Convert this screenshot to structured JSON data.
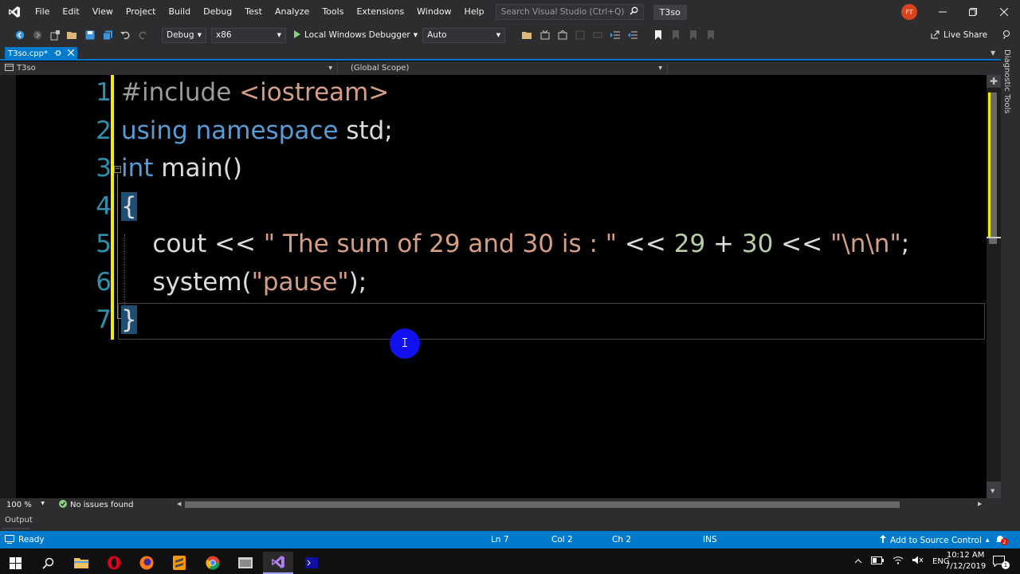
{
  "menubar": {
    "items": [
      "File",
      "Edit",
      "View",
      "Project",
      "Build",
      "Debug",
      "Test",
      "Analyze",
      "Tools",
      "Extensions",
      "Window",
      "Help"
    ],
    "search_placeholder": "Search Visual Studio (Ctrl+Q)",
    "solution_title": "T3so",
    "user_initials": "FT"
  },
  "toolbar": {
    "configuration": "Debug",
    "platform": "x86",
    "run_label": "Local Windows Debugger",
    "run_mode": "Auto",
    "live_share": "Live Share"
  },
  "tabs": [
    {
      "label": "T3so.cpp*",
      "active": true
    }
  ],
  "navbar": {
    "project": "T3so",
    "scope": "(Global Scope)"
  },
  "side_panel": {
    "diagnostic_tools": "Diagnostic Tools"
  },
  "editor": {
    "line_numbers": [
      "1",
      "2",
      "3",
      "4",
      "5",
      "6",
      "7"
    ],
    "lines": [
      [
        {
          "t": "#include ",
          "c": "pp"
        },
        {
          "t": "<iostream>",
          "c": "str"
        }
      ],
      [
        {
          "t": "using",
          "c": "kw"
        },
        {
          "t": " ",
          "c": ""
        },
        {
          "t": "namespace",
          "c": "kw"
        },
        {
          "t": " std;",
          "c": ""
        }
      ],
      [
        {
          "t": "int",
          "c": "kw"
        },
        {
          "t": " main()",
          "c": ""
        }
      ],
      [
        {
          "t": "{",
          "c": "brace"
        }
      ],
      [
        {
          "t": "    cout << ",
          "c": ""
        },
        {
          "t": "\" The sum of 29 and 30 is : \"",
          "c": "str"
        },
        {
          "t": " << ",
          "c": ""
        },
        {
          "t": "29",
          "c": "num"
        },
        {
          "t": " + ",
          "c": ""
        },
        {
          "t": "30",
          "c": "num"
        },
        {
          "t": " << ",
          "c": ""
        },
        {
          "t": "\"\\n\\n\"",
          "c": "str"
        },
        {
          "t": ";",
          "c": ""
        }
      ],
      [
        {
          "t": "    system(",
          "c": ""
        },
        {
          "t": "\"pause\"",
          "c": "str"
        },
        {
          "t": ");",
          "c": ""
        }
      ],
      [
        {
          "t": "}",
          "c": "brace"
        }
      ]
    ],
    "current_line": 7,
    "fold_marker": "−"
  },
  "editor_footer": {
    "zoom": "100 %",
    "issues": "No issues found"
  },
  "output_panel": {
    "label": "Output"
  },
  "statusbar": {
    "state": "Ready",
    "line": "Ln 7",
    "col": "Col 2",
    "ch": "Ch 2",
    "mode": "INS",
    "source_control": "Add to Source Control",
    "notification_count": "2"
  },
  "taskbar": {
    "language": "ENG",
    "time": "10:12 AM",
    "date": "7/12/2019",
    "notification_count": "1"
  },
  "colors": {
    "accent": "#007acc",
    "chrome": "#2d2d30",
    "line_number": "#2b91af",
    "keyword": "#569cd6",
    "string": "#d69d85",
    "number": "#b5cea8",
    "change_bar": "#efef00"
  }
}
